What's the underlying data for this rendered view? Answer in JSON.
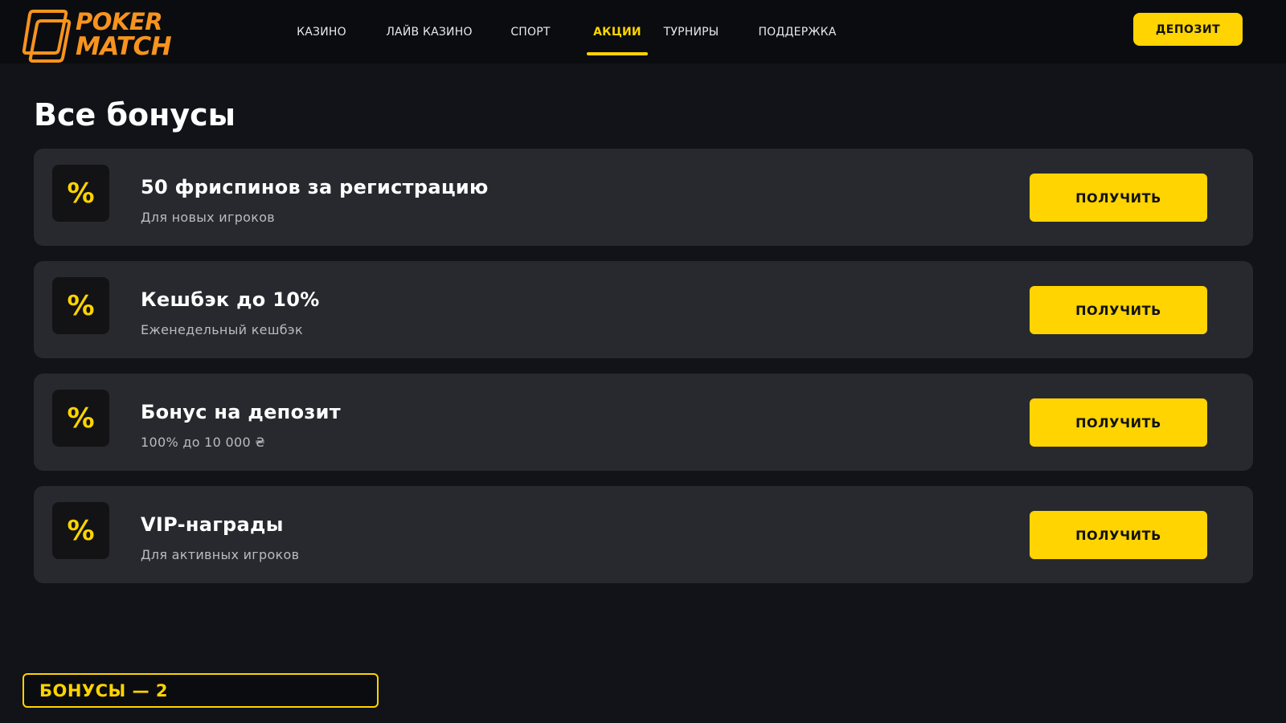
{
  "brand": {
    "line1": "POKER",
    "line2": "MATCH",
    "color": "#f7931e"
  },
  "nav": {
    "items": [
      {
        "label": "КАЗИНО",
        "active": false
      },
      {
        "label": "ЛАЙВ КАЗИНО",
        "active": false
      },
      {
        "label": "СПОРТ",
        "active": false
      },
      {
        "label": "АКЦИИ",
        "active": true
      },
      {
        "label": "ТУРНИРЫ",
        "active": false
      },
      {
        "label": "ПОДДЕРЖКА",
        "active": false
      }
    ],
    "deposit_label": "ДЕПОЗИТ"
  },
  "page": {
    "title": "Все бонусы"
  },
  "bonuses": [
    {
      "icon": "percent-icon",
      "icon_glyph": "%",
      "title": "50 фриспинов за регистрацию",
      "subtitle": "Для новых игроков",
      "button": "ПОЛУЧИТЬ"
    },
    {
      "icon": "percent-icon",
      "icon_glyph": "%",
      "title": "Кешбэк до 10%",
      "subtitle": "Еженедельный кешбэк",
      "button": "ПОЛУЧИТЬ"
    },
    {
      "icon": "percent-icon",
      "icon_glyph": "%",
      "title": "Бонус на депозит",
      "subtitle": "100% до 10 000 ₴",
      "button": "ПОЛУЧИТЬ"
    },
    {
      "icon": "percent-icon",
      "icon_glyph": "%",
      "title": "VIP-награды",
      "subtitle": "Для активных игроков",
      "button": "ПОЛУЧИТЬ"
    }
  ],
  "counter": {
    "label": "БОНУСЫ — 2"
  },
  "colors": {
    "accent": "#ffd400",
    "background": "#111318",
    "header": "#0b0c0f",
    "card": "#28292e"
  }
}
